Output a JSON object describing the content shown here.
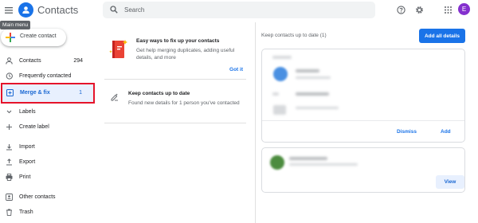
{
  "header": {
    "app_title": "Contacts",
    "menu_tooltip": "Main menu",
    "search_placeholder": "Search",
    "avatar_letter": "E",
    "icons": [
      "menu-icon",
      "contacts-logo-icon",
      "search-icon",
      "help-icon",
      "settings-icon",
      "apps-grid-icon"
    ]
  },
  "create_button": {
    "label": "Create contact"
  },
  "sidebar": {
    "items": [
      {
        "label": "Contacts",
        "count": "294",
        "icon": "person-icon"
      },
      {
        "label": "Frequently contacted",
        "count": "",
        "icon": "history-icon"
      },
      {
        "label": "Merge & fix",
        "count": "1",
        "icon": "merge-icon",
        "active": true
      },
      {
        "label": "Labels",
        "count": "",
        "icon": "chevron-icon"
      },
      {
        "label": "Create label",
        "count": "",
        "icon": "plus-icon"
      },
      {
        "label": "Import",
        "count": "",
        "icon": "import-icon"
      },
      {
        "label": "Export",
        "count": "",
        "icon": "export-icon"
      },
      {
        "label": "Print",
        "count": "",
        "icon": "print-icon"
      },
      {
        "label": "Other contacts",
        "count": "",
        "icon": "other-contacts-icon"
      },
      {
        "label": "Trash",
        "count": "",
        "icon": "trash-icon"
      }
    ]
  },
  "tips": {
    "fix_title": "Easy ways to fix up your contacts",
    "fix_desc": "Get help merging duplicates, adding useful details, and more",
    "fix_action": "Got it",
    "update_title": "Keep contacts up to date",
    "update_desc": "Found new details for 1 person you've contacted"
  },
  "suggestions": {
    "heading": "Keep contacts up to date (1)",
    "add_all_label": "Add all details",
    "dismiss_label": "Dismiss",
    "add_label": "Add",
    "view_label": "View"
  },
  "colors": {
    "accent": "#1a73e8",
    "active_bg": "#e8f0fe",
    "highlight_border": "#e5142a",
    "avatar": "#8430ce"
  }
}
